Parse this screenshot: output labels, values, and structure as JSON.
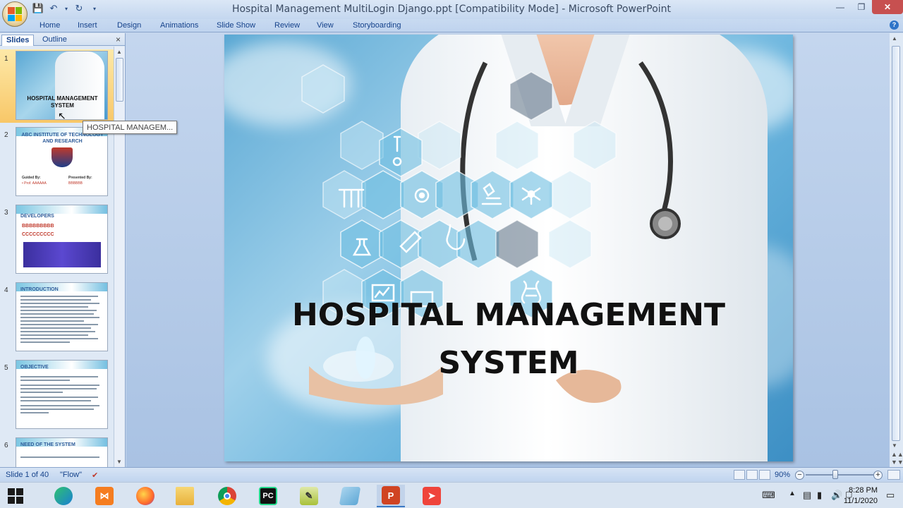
{
  "window": {
    "title": "Hospital Management MultiLogin Django.ppt [Compatibility Mode] - Microsoft PowerPoint"
  },
  "ribbon": {
    "tabs": [
      "Home",
      "Insert",
      "Design",
      "Animations",
      "Slide Show",
      "Review",
      "View",
      "Storyboarding"
    ]
  },
  "left_pane": {
    "tabs": [
      "Slides",
      "Outline"
    ],
    "tooltip": "HOSPITAL MANAGEM...",
    "thumbnails": [
      {
        "num": "1",
        "title": "HOSPITAL MANAGEMENT SYSTEM"
      },
      {
        "num": "2",
        "title": "ABC INSTITUTE OF TECHNOLOGY AND RESEARCH",
        "guided_label": "Guided By:",
        "guided_value": "• Prof. AAAAAA",
        "presented_label": "Presented By:",
        "presented_value": "BBBBBB"
      },
      {
        "num": "3",
        "title": "DEVELOPERS",
        "item1": "BBBBBBBBB",
        "item2": "CCCCCCCCC"
      },
      {
        "num": "4",
        "title": "INTRODUCTION"
      },
      {
        "num": "5",
        "title": "OBJECTIVE"
      },
      {
        "num": "6",
        "title": "NEED OF THE SYSTEM"
      }
    ]
  },
  "slide": {
    "title_line1": "HOSPITAL MANAGEMENT",
    "title_line2": "SYSTEM"
  },
  "statusbar": {
    "slide_info": "Slide 1 of 40",
    "theme": "\"Flow\"",
    "zoom": "90%"
  },
  "taskbar": {
    "time": "8:28 PM",
    "date": "11/1/2020"
  },
  "colors": {
    "accent": "#15428b",
    "selection": "#f8c768",
    "close": "#c75050"
  }
}
